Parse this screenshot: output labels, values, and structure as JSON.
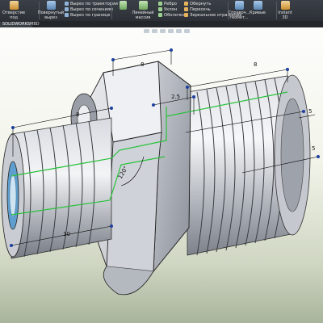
{
  "ribbon": {
    "open_thread_item": "Отверстие под крепеж",
    "rotated_boss": "Повернутый вырез",
    "sweep_cut": "Вырез по траектории",
    "loft_cut": "Вырез по сечениям",
    "boundary_cut": "Вырез по границе",
    "rib_group": [
      "Ребро",
      "Уклон",
      "Оболочка"
    ],
    "linear_pattern": "Линейный массив",
    "wrap_group": [
      "Обернуть",
      "Пересечь",
      "Зеркальное отражение"
    ],
    "reference_geometry": "Справоч... геомет...",
    "curves": "Кривые",
    "instant3d": "Instant 3D"
  },
  "tabs": [
    "SOLIDWORKS",
    "MBD"
  ],
  "dimensions": {
    "top_left": "8",
    "top_right": "8",
    "left_mid": "8",
    "small_mid": "2.5",
    "angle": "120°",
    "bottom_left": "10",
    "right_small": "5",
    "right_bottom": "5"
  },
  "colors": {
    "ribbon_bg": "#2c3036",
    "viewport_top": "#fdfdfc",
    "viewport_bottom": "#a9b49c",
    "sketch_line": "#27c23a",
    "dimension_line": "#000000",
    "part_gray": "#b9bcc2"
  }
}
